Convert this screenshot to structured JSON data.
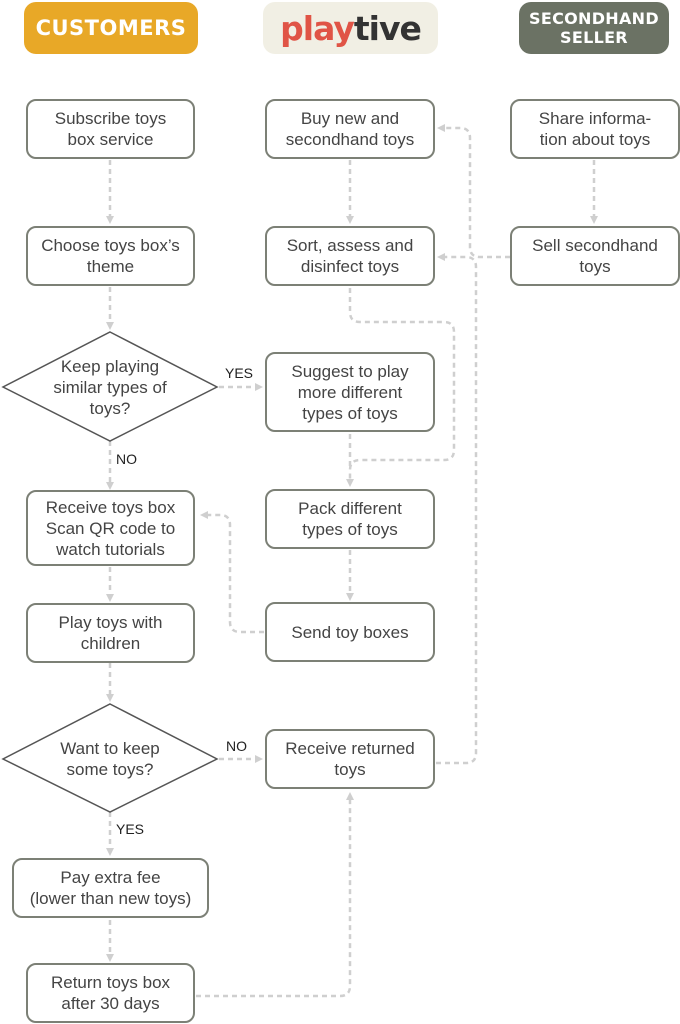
{
  "headers": {
    "customers": "CUSTOMERS",
    "brand_part1": "play",
    "brand_part2": "tive",
    "seller": "SECONDHAND\nSELLER"
  },
  "colors": {
    "customers": "#e8a827",
    "brand_bg": "#f1efe4",
    "brand_red": "#e05446",
    "seller": "#6b7264",
    "node_border": "#7c8076",
    "connector": "#cfcfcf"
  },
  "customers": {
    "subscribe": "Subscribe toys\nbox service",
    "choose_theme": "Choose toys box’s\ntheme",
    "decision_keep_playing": "Keep playing\nsimilar types of\ntoys?",
    "receive_box": "Receive toys box\nScan QR code to\nwatch tutorials",
    "play": "Play toys with\nchildren",
    "decision_keep_toys": "Want to keep\nsome toys?",
    "pay_fee": "Pay extra fee\n(lower than new toys)",
    "return_box": "Return toys box\nafter 30 days"
  },
  "playtive": {
    "buy": "Buy new and\nsecondhand toys",
    "sort": "Sort, assess and\ndisinfect toys",
    "suggest": "Suggest to play\nmore different\ntypes of toys",
    "pack": "Pack different\ntypes of toys",
    "send": "Send toy boxes",
    "receive_returned": "Receive returned\ntoys"
  },
  "seller": {
    "share": "Share informa-\ntion about toys",
    "sell": "Sell secondhand\ntoys"
  },
  "labels": {
    "yes1": "YES",
    "no1": "NO",
    "no2": "NO",
    "yes2": "YES"
  }
}
